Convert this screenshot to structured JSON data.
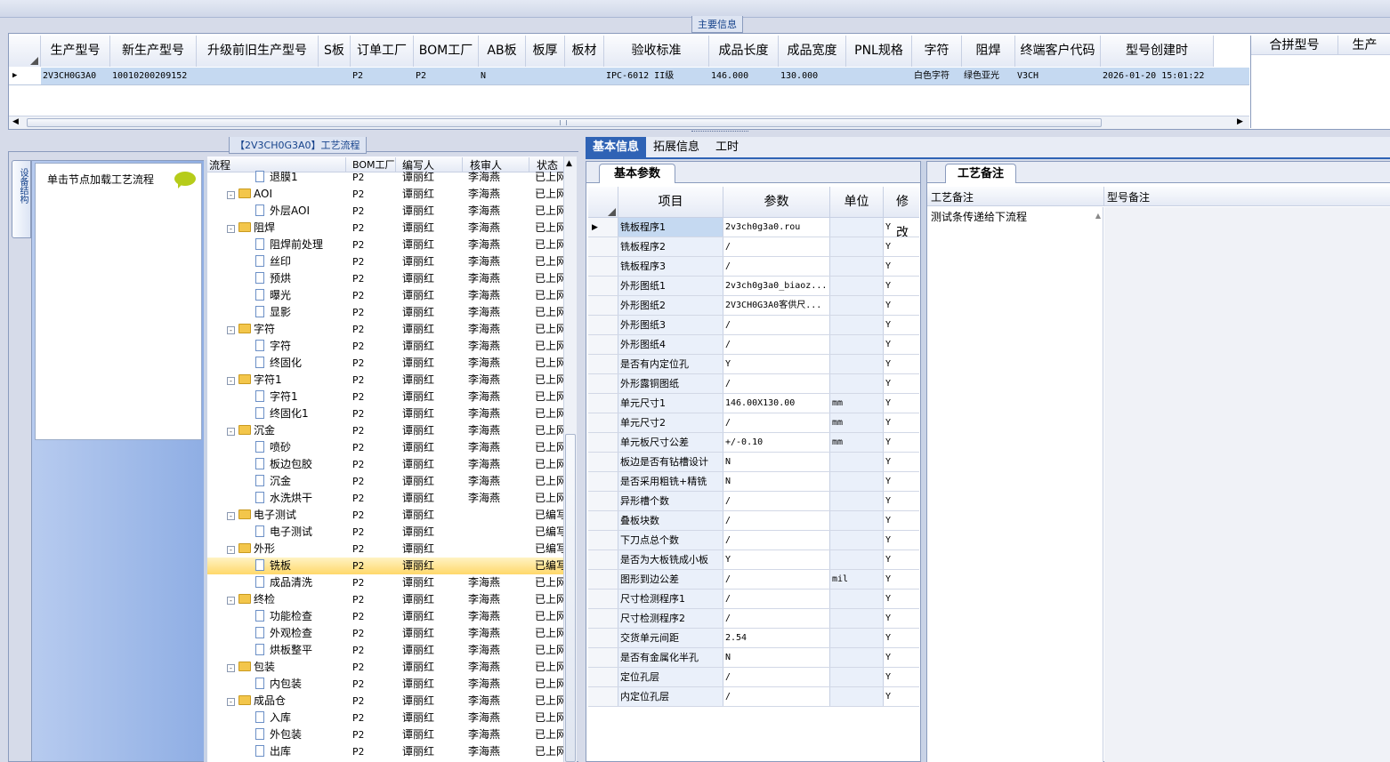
{
  "main_info": {
    "caption": "主要信息",
    "columns": [
      "生产型号",
      "新生产型号",
      "升级前旧生产型号",
      "S板",
      "订单工厂",
      "BOM工厂",
      "AB板",
      "板厚",
      "板材",
      "验收标准",
      "成品长度",
      "成品宽度",
      "PNL规格",
      "字符",
      "阻焊",
      "终端客户代码",
      "型号创建时"
    ],
    "row": [
      "2V3CH0G3A0",
      "10010200209152",
      "",
      "",
      "P2",
      "P2",
      "N",
      "",
      "",
      "IPC-6012 II级",
      "146.000",
      "130.000",
      "",
      "白色字符",
      "绿色亚光",
      "V3CH",
      "2026-01-20 15:01:22"
    ],
    "side_columns": [
      "合拼型号",
      "生产"
    ]
  },
  "left_panel": {
    "vertical_tab": "设备结构",
    "hint": "单击节点加载工艺流程"
  },
  "process": {
    "caption": "【2V3CH0G3A0】工艺流程",
    "columns": [
      "流程",
      "BOM工厂",
      "编写人",
      "核审人",
      "状态"
    ],
    "rows": [
      {
        "level": 1,
        "type": "doc",
        "name": "退膜1",
        "factory": "P2",
        "writer": "谭丽红",
        "reviewer": "李海燕",
        "status": "已上网"
      },
      {
        "level": 0,
        "type": "folder",
        "name": "AOI",
        "factory": "P2",
        "writer": "谭丽红",
        "reviewer": "李海燕",
        "status": "已上网"
      },
      {
        "level": 1,
        "type": "doc",
        "name": "外层AOI",
        "factory": "P2",
        "writer": "谭丽红",
        "reviewer": "李海燕",
        "status": "已上网"
      },
      {
        "level": 0,
        "type": "folder",
        "name": "阻焊",
        "factory": "P2",
        "writer": "谭丽红",
        "reviewer": "李海燕",
        "status": "已上网"
      },
      {
        "level": 1,
        "type": "doc",
        "name": "阻焊前处理",
        "factory": "P2",
        "writer": "谭丽红",
        "reviewer": "李海燕",
        "status": "已上网"
      },
      {
        "level": 1,
        "type": "doc",
        "name": "丝印",
        "factory": "P2",
        "writer": "谭丽红",
        "reviewer": "李海燕",
        "status": "已上网"
      },
      {
        "level": 1,
        "type": "doc",
        "name": "预烘",
        "factory": "P2",
        "writer": "谭丽红",
        "reviewer": "李海燕",
        "status": "已上网"
      },
      {
        "level": 1,
        "type": "doc",
        "name": "曝光",
        "factory": "P2",
        "writer": "谭丽红",
        "reviewer": "李海燕",
        "status": "已上网"
      },
      {
        "level": 1,
        "type": "doc",
        "name": "显影",
        "factory": "P2",
        "writer": "谭丽红",
        "reviewer": "李海燕",
        "status": "已上网"
      },
      {
        "level": 0,
        "type": "folder",
        "name": "字符",
        "factory": "P2",
        "writer": "谭丽红",
        "reviewer": "李海燕",
        "status": "已上网"
      },
      {
        "level": 1,
        "type": "doc",
        "name": "字符",
        "factory": "P2",
        "writer": "谭丽红",
        "reviewer": "李海燕",
        "status": "已上网"
      },
      {
        "level": 1,
        "type": "doc",
        "name": "终固化",
        "factory": "P2",
        "writer": "谭丽红",
        "reviewer": "李海燕",
        "status": "已上网"
      },
      {
        "level": 0,
        "type": "folder",
        "name": "字符1",
        "factory": "P2",
        "writer": "谭丽红",
        "reviewer": "李海燕",
        "status": "已上网"
      },
      {
        "level": 1,
        "type": "doc",
        "name": "字符1",
        "factory": "P2",
        "writer": "谭丽红",
        "reviewer": "李海燕",
        "status": "已上网"
      },
      {
        "level": 1,
        "type": "doc",
        "name": "终固化1",
        "factory": "P2",
        "writer": "谭丽红",
        "reviewer": "李海燕",
        "status": "已上网"
      },
      {
        "level": 0,
        "type": "folder",
        "name": "沉金",
        "factory": "P2",
        "writer": "谭丽红",
        "reviewer": "李海燕",
        "status": "已上网"
      },
      {
        "level": 1,
        "type": "doc",
        "name": "喷砂",
        "factory": "P2",
        "writer": "谭丽红",
        "reviewer": "李海燕",
        "status": "已上网"
      },
      {
        "level": 1,
        "type": "doc",
        "name": "板边包胶",
        "factory": "P2",
        "writer": "谭丽红",
        "reviewer": "李海燕",
        "status": "已上网"
      },
      {
        "level": 1,
        "type": "doc",
        "name": "沉金",
        "factory": "P2",
        "writer": "谭丽红",
        "reviewer": "李海燕",
        "status": "已上网"
      },
      {
        "level": 1,
        "type": "doc",
        "name": "水洗烘干",
        "factory": "P2",
        "writer": "谭丽红",
        "reviewer": "李海燕",
        "status": "已上网"
      },
      {
        "level": 0,
        "type": "folder",
        "name": "电子测试",
        "factory": "P2",
        "writer": "谭丽红",
        "reviewer": "",
        "status": "已编写"
      },
      {
        "level": 1,
        "type": "doc",
        "name": "电子测试",
        "factory": "P2",
        "writer": "谭丽红",
        "reviewer": "",
        "status": "已编写"
      },
      {
        "level": 0,
        "type": "folder",
        "name": "外形",
        "factory": "P2",
        "writer": "谭丽红",
        "reviewer": "",
        "status": "已编写"
      },
      {
        "level": 1,
        "type": "doc",
        "name": "铣板",
        "factory": "P2",
        "writer": "谭丽红",
        "reviewer": "",
        "status": "已编写",
        "selected": true
      },
      {
        "level": 1,
        "type": "doc",
        "name": "成品清洗",
        "factory": "P2",
        "writer": "谭丽红",
        "reviewer": "李海燕",
        "status": "已上网"
      },
      {
        "level": 0,
        "type": "folder",
        "name": "终检",
        "factory": "P2",
        "writer": "谭丽红",
        "reviewer": "李海燕",
        "status": "已上网"
      },
      {
        "level": 1,
        "type": "doc",
        "name": "功能检查",
        "factory": "P2",
        "writer": "谭丽红",
        "reviewer": "李海燕",
        "status": "已上网"
      },
      {
        "level": 1,
        "type": "doc",
        "name": "外观检查",
        "factory": "P2",
        "writer": "谭丽红",
        "reviewer": "李海燕",
        "status": "已上网"
      },
      {
        "level": 1,
        "type": "doc",
        "name": "烘板整平",
        "factory": "P2",
        "writer": "谭丽红",
        "reviewer": "李海燕",
        "status": "已上网"
      },
      {
        "level": 0,
        "type": "folder",
        "name": "包装",
        "factory": "P2",
        "writer": "谭丽红",
        "reviewer": "李海燕",
        "status": "已上网"
      },
      {
        "level": 1,
        "type": "doc",
        "name": "内包装",
        "factory": "P2",
        "writer": "谭丽红",
        "reviewer": "李海燕",
        "status": "已上网"
      },
      {
        "level": 0,
        "type": "folder",
        "name": "成品仓",
        "factory": "P2",
        "writer": "谭丽红",
        "reviewer": "李海燕",
        "status": "已上网"
      },
      {
        "level": 1,
        "type": "doc",
        "name": "入库",
        "factory": "P2",
        "writer": "谭丽红",
        "reviewer": "李海燕",
        "status": "已上网"
      },
      {
        "level": 1,
        "type": "doc",
        "name": "外包装",
        "factory": "P2",
        "writer": "谭丽红",
        "reviewer": "李海燕",
        "status": "已上网"
      },
      {
        "level": 1,
        "type": "doc",
        "name": "出库",
        "factory": "P2",
        "writer": "谭丽红",
        "reviewer": "李海燕",
        "status": "已上网"
      }
    ]
  },
  "tabs": [
    "基本信息",
    "拓展信息",
    "工时"
  ],
  "basic_params": {
    "caption": "基本参数",
    "columns": [
      "项目",
      "参数",
      "单位",
      "修改"
    ],
    "rows": [
      [
        "铣板程序1",
        "2v3ch0g3a0.rou",
        "",
        "Y"
      ],
      [
        "铣板程序2",
        "/",
        "",
        "Y"
      ],
      [
        "铣板程序3",
        "/",
        "",
        "Y"
      ],
      [
        "外形图纸1",
        "2v3ch0g3a0_biaoz...",
        "",
        "Y"
      ],
      [
        "外形图纸2",
        "2V3CH0G3A0客供尺...",
        "",
        "Y"
      ],
      [
        "外形图纸3",
        "/",
        "",
        "Y"
      ],
      [
        "外形图纸4",
        "/",
        "",
        "Y"
      ],
      [
        "是否有内定位孔",
        "Y",
        "",
        "Y"
      ],
      [
        "外形露铜图纸",
        "/",
        "",
        "Y"
      ],
      [
        "单元尺寸1",
        "146.00X130.00",
        "mm",
        "Y"
      ],
      [
        "单元尺寸2",
        "/",
        "mm",
        "Y"
      ],
      [
        "单元板尺寸公差",
        "+/-0.10",
        "mm",
        "Y"
      ],
      [
        "板边是否有钻槽设计",
        "N",
        "",
        "Y"
      ],
      [
        "是否采用粗铣+精铣",
        "N",
        "",
        "Y"
      ],
      [
        "异形槽个数",
        "/",
        "",
        "Y"
      ],
      [
        "叠板块数",
        "/",
        "",
        "Y"
      ],
      [
        "下刀点总个数",
        "/",
        "",
        "Y"
      ],
      [
        "是否为大板铣成小板",
        "Y",
        "",
        "Y"
      ],
      [
        "图形到边公差",
        "/",
        "mil",
        "Y"
      ],
      [
        "尺寸检测程序1",
        "/",
        "",
        "Y"
      ],
      [
        "尺寸检测程序2",
        "/",
        "",
        "Y"
      ],
      [
        "交货单元间距",
        "2.54",
        "",
        "Y"
      ],
      [
        "是否有金属化半孔",
        "N",
        "",
        "Y"
      ],
      [
        "定位孔层",
        "/",
        "",
        "Y"
      ],
      [
        "内定位孔层",
        "/",
        "",
        "Y"
      ]
    ]
  },
  "process_notes": {
    "caption": "工艺备注",
    "col1": "工艺备注",
    "col2": "型号备注",
    "note_text": "测试条传递给下流程"
  },
  "colors": {
    "selected_row": "#c5d9f1",
    "tab_active": "#2f63b5",
    "panel_blue": "#9fb8e6"
  }
}
